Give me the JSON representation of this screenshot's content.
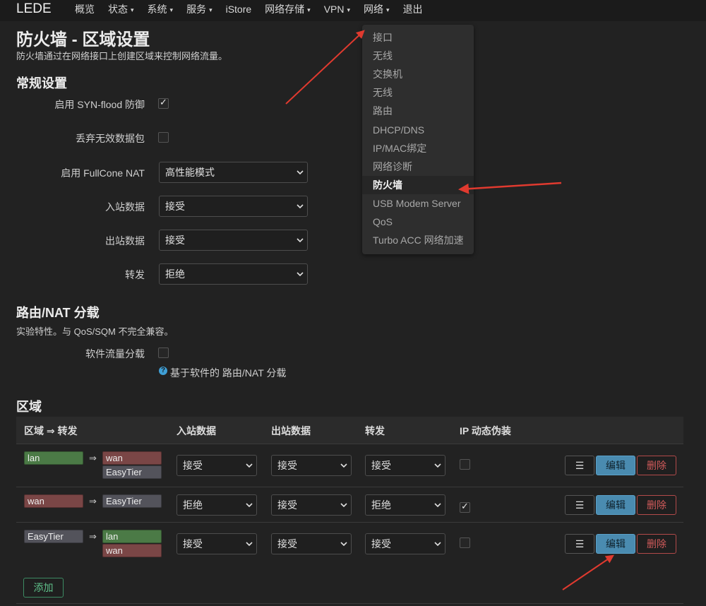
{
  "nav": {
    "brand": "LEDE",
    "items": [
      {
        "label": "概览",
        "caret": false
      },
      {
        "label": "状态",
        "caret": true
      },
      {
        "label": "系统",
        "caret": true
      },
      {
        "label": "服务",
        "caret": true
      },
      {
        "label": "iStore",
        "caret": false
      },
      {
        "label": "网络存储",
        "caret": true
      },
      {
        "label": "VPN",
        "caret": true
      },
      {
        "label": "网络",
        "caret": true
      },
      {
        "label": "退出",
        "caret": false
      }
    ]
  },
  "dropdown": {
    "items": [
      "接口",
      "无线",
      "交换机",
      "无线",
      "路由",
      "DHCP/DNS",
      "IP/MAC绑定",
      "网络诊断",
      "防火墙",
      "USB Modem Server",
      "QoS",
      "Turbo ACC 网络加速"
    ],
    "active": "防火墙"
  },
  "page": {
    "title": "防火墙 - 区域设置",
    "description": "防火墙通过在网络接口上创建区域来控制网络流量。"
  },
  "general": {
    "heading": "常规设置",
    "syn_flood_label": "启用 SYN-flood 防御",
    "syn_flood_checked": true,
    "drop_invalid_label": "丢弃无效数据包",
    "drop_invalid_checked": false,
    "fullcone_label": "启用 FullCone NAT",
    "fullcone_value": "高性能模式",
    "input_label": "入站数据",
    "input_value": "接受",
    "output_label": "出站数据",
    "output_value": "接受",
    "forward_label": "转发",
    "forward_value": "拒绝"
  },
  "offload": {
    "heading": "路由/NAT 分载",
    "description": "实验特性。与 QoS/SQM 不完全兼容。",
    "software_label": "软件流量分载",
    "software_checked": false,
    "help_text": "基于软件的 路由/NAT 分载",
    "help_icon": "question-circle-icon"
  },
  "zones": {
    "heading": "区域",
    "columns": {
      "zone": "区域 ⇒ 转发",
      "input": "入站数据",
      "output": "出站数据",
      "forward": "转发",
      "masq": "IP 动态伪装"
    },
    "arrow": "⇒",
    "rows": [
      {
        "zone": "lan",
        "zone_color": "green",
        "targets": [
          {
            "name": "wan",
            "color": "red"
          },
          {
            "name": "EasyTier",
            "color": "grey"
          }
        ],
        "input": "接受",
        "output": "接受",
        "forward": "接受",
        "masq": false
      },
      {
        "zone": "wan",
        "zone_color": "red",
        "targets": [
          {
            "name": "EasyTier",
            "color": "grey"
          }
        ],
        "input": "拒绝",
        "output": "接受",
        "forward": "拒绝",
        "masq": true
      },
      {
        "zone": "EasyTier",
        "zone_color": "grey",
        "targets": [
          {
            "name": "lan",
            "color": "green"
          },
          {
            "name": "wan",
            "color": "red"
          }
        ],
        "input": "接受",
        "output": "接受",
        "forward": "接受",
        "masq": false
      }
    ],
    "menu_label": "☰",
    "edit_label": "编辑",
    "delete_label": "删除",
    "add_label": "添加"
  },
  "colors": {
    "background": "#222222",
    "topbar": "#1b1b1b",
    "annotation_arrow": "#e03a2f",
    "edit_button": "#4a8bb0",
    "delete_border": "#b24a4a",
    "add_border": "#3d8b63",
    "zone_green": "#4b7a46",
    "zone_red": "#7a4646",
    "zone_grey": "#53535b"
  }
}
